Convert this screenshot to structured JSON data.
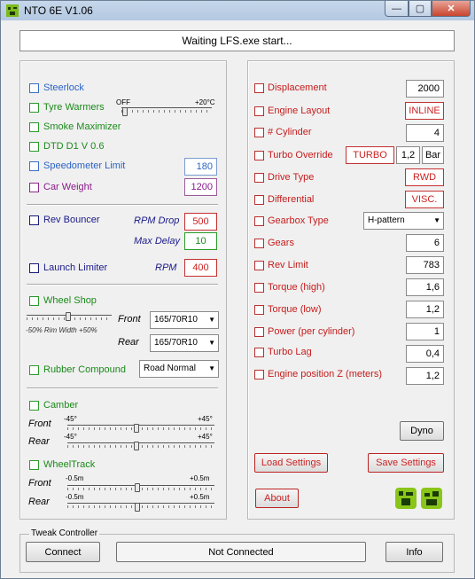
{
  "window": {
    "title": "NTO 6E V1.06",
    "min": "—",
    "max": "▢",
    "close": "✕"
  },
  "status": "Waiting LFS.exe start...",
  "left": {
    "steerlock": "Steerlock",
    "tyre_warmers": "Tyre Warmers",
    "tyre_off": "OFF",
    "tyre_max": "+20°C",
    "smoke": "Smoke Maximizer",
    "dtd": "DTD D1 V 0.6",
    "speedo": "Speedometer Limit",
    "speedo_val": "180",
    "car_weight": "Car Weight",
    "car_weight_val": "1200",
    "rev_bouncer": "Rev Bouncer",
    "rpm_drop": "RPM Drop",
    "rpm_drop_val": "500",
    "max_delay": "Max Delay",
    "max_delay_val": "10",
    "launch": "Launch Limiter",
    "rpm": "RPM",
    "rpm_val": "400",
    "wheel_shop": "Wheel Shop",
    "rim_width": "-50% Rim Width +50%",
    "front": "Front",
    "front_tyre": "165/70R10",
    "rear": "Rear",
    "rear_tyre": "165/70R10",
    "rubber": "Rubber Compound",
    "rubber_val": "Road Normal",
    "camber": "Camber",
    "camber_front": "Front",
    "camber_rear": "Rear",
    "camber_min": "-45°",
    "camber_max": "+45°",
    "wheeltrack": "WheelTrack",
    "wt_front": "Front",
    "wt_rear": "Rear",
    "wt_min": "-0.5m",
    "wt_max": "+0.5m"
  },
  "right": {
    "displacement": "Displacement",
    "displacement_val": "2000",
    "engine_layout": "Engine Layout",
    "engine_layout_val": "INLINE",
    "cylinder": "# Cylinder",
    "cylinder_val": "4",
    "turbo_override": "Turbo Override",
    "turbo": "TURBO",
    "turbo_val": "1,2",
    "bar": "Bar",
    "drive_type": "Drive Type",
    "drive_type_val": "RWD",
    "differential": "Differential",
    "differential_val": "VISC.",
    "gearbox": "Gearbox Type",
    "gearbox_val": "H-pattern",
    "gears": "Gears",
    "gears_val": "6",
    "rev_limit": "Rev Limit",
    "rev_limit_val": "783",
    "torque_high": "Torque (high)",
    "torque_high_val": "1,6",
    "torque_low": "Torque (low)",
    "torque_low_val": "1,2",
    "power": "Power (per cylinder)",
    "power_val": "1",
    "turbo_lag": "Turbo Lag",
    "turbo_lag_val": "0,4",
    "engine_pos": "Engine position Z (meters)",
    "engine_pos_val": "1,2",
    "dyno": "Dyno",
    "load": "Load Settings",
    "save": "Save Settings",
    "about": "About"
  },
  "tweak": {
    "title": "Tweak Controller",
    "connect": "Connect",
    "status": "Not Connected",
    "info": "Info"
  }
}
